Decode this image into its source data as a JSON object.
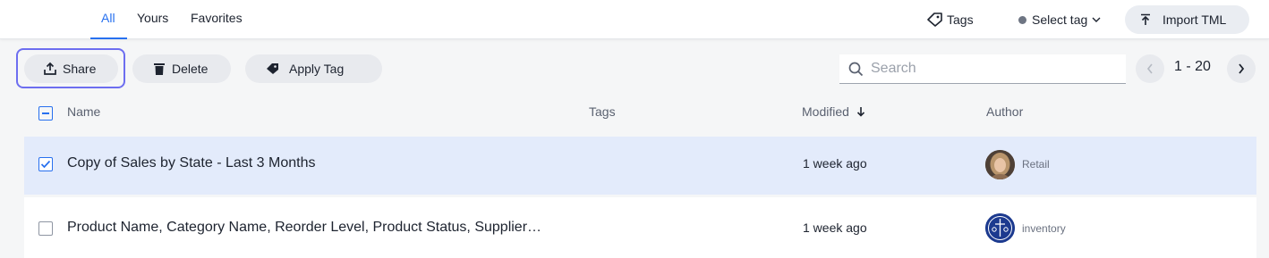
{
  "tabs": [
    {
      "label": "All",
      "active": true
    },
    {
      "label": "Yours",
      "active": false
    },
    {
      "label": "Favorites",
      "active": false
    }
  ],
  "topbar": {
    "tags_label": "Tags",
    "select_tag_label": "Select tag",
    "import_label": "Import TML"
  },
  "toolbar": {
    "share_label": "Share",
    "delete_label": "Delete",
    "apply_tag_label": "Apply Tag"
  },
  "search": {
    "placeholder": "Search",
    "value": ""
  },
  "pagination": {
    "range": "1 - 20"
  },
  "table": {
    "columns": {
      "name": "Name",
      "tags": "Tags",
      "modified": "Modified",
      "author": "Author"
    },
    "sort_column": "Modified",
    "sort_direction": "descending",
    "rows": [
      {
        "name": "Copy of Sales by State - Last 3 Months",
        "tags": "",
        "modified": "1 week ago",
        "author": "Retail",
        "selected": true
      },
      {
        "name": "Product Name, Category Name, Reorder Level, Product Status, Supplier…",
        "tags": "",
        "modified": "1 week ago",
        "author": "inventory",
        "selected": false
      }
    ]
  },
  "colors": {
    "accent": "#2770ef",
    "focus_ring": "#6d6ef0",
    "selected_row": "#e3ebfb",
    "background": "#f5f6f7"
  },
  "icons": {
    "share": "share-upload-icon",
    "delete": "trash-icon",
    "apply_tag": "tag-icon",
    "import": "import-icon",
    "search": "search-icon",
    "prev": "chevron-left-icon",
    "next": "chevron-right-icon",
    "sort": "arrow-down-icon"
  }
}
